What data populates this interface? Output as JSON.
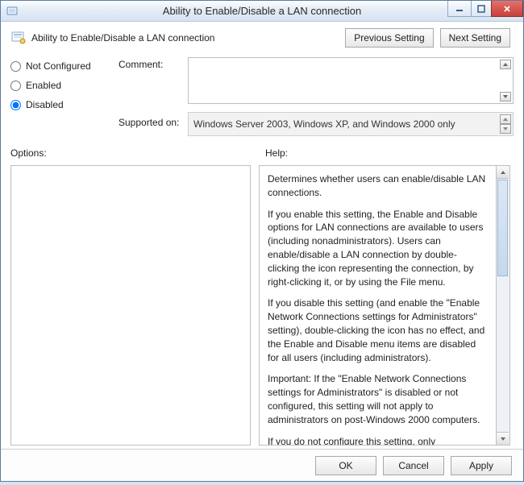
{
  "titlebar": {
    "title": "Ability to Enable/Disable a LAN connection"
  },
  "policy_title": "Ability to Enable/Disable a LAN connection",
  "nav": {
    "prev": "Previous Setting",
    "next": "Next Setting"
  },
  "state": {
    "not_configured": "Not Configured",
    "enabled": "Enabled",
    "disabled": "Disabled",
    "selected": "disabled"
  },
  "fields": {
    "comment_label": "Comment:",
    "comment": "",
    "supported_label": "Supported on:",
    "supported": "Windows Server 2003, Windows XP, and Windows 2000 only"
  },
  "labels": {
    "options": "Options:",
    "help": "Help:"
  },
  "help_paragraphs": [
    "Determines whether users can enable/disable LAN connections.",
    "If you enable this setting, the Enable and Disable options for LAN connections are available to users (including nonadministrators). Users can enable/disable a LAN connection by double-clicking the icon representing the connection, by right-clicking it, or by using the File menu.",
    "If you disable this setting (and enable the \"Enable Network Connections settings for Administrators\" setting), double-clicking the icon has no effect, and the Enable and Disable menu items are disabled for all users (including administrators).",
    "Important: If the \"Enable Network Connections settings for Administrators\" is disabled or not configured, this setting will not apply to administrators on post-Windows 2000 computers.",
    "If you do not configure this setting, only Administrators and Network Configuration Operators can enable/disable LAN connections."
  ],
  "footer": {
    "ok": "OK",
    "cancel": "Cancel",
    "apply": "Apply"
  }
}
